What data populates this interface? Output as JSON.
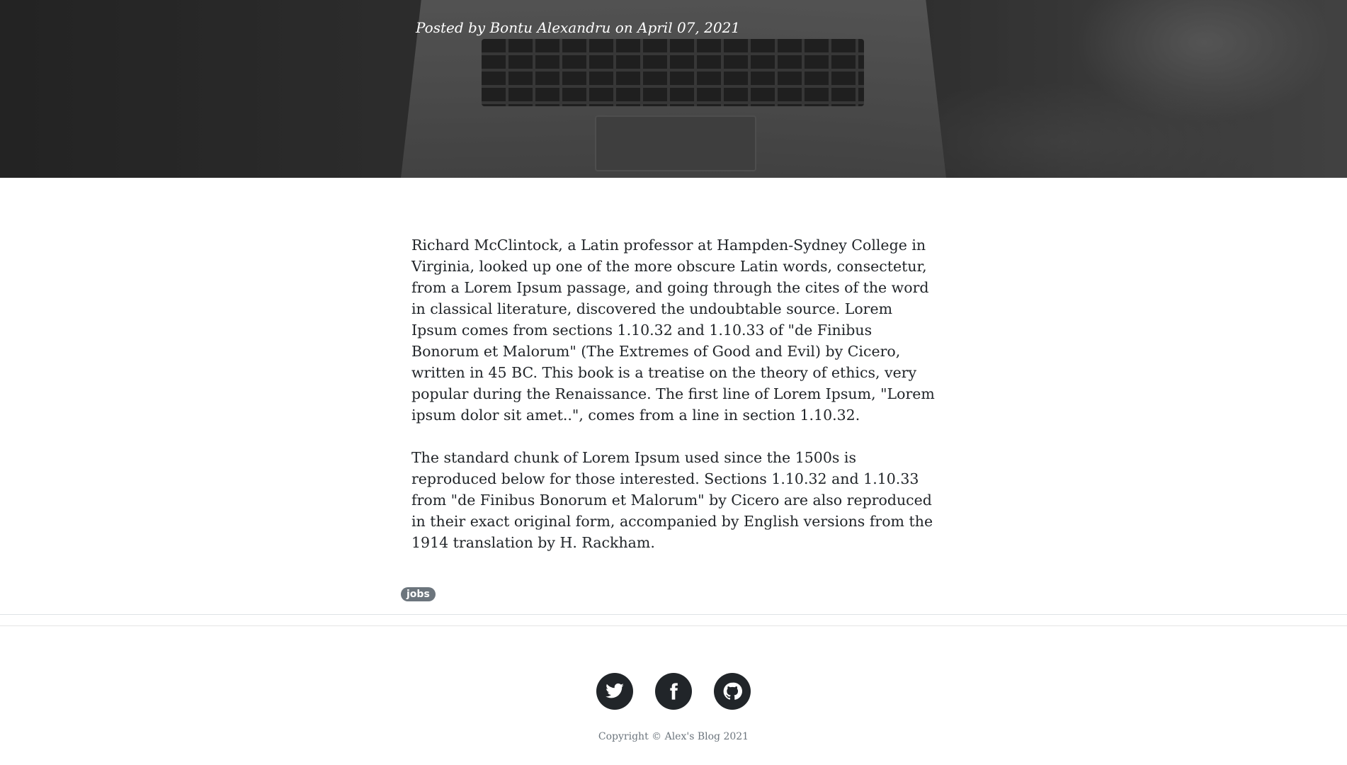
{
  "post": {
    "meta_prefix": "Posted by",
    "author": "Bontu Alexandru",
    "meta_middle": "on",
    "date": "April 07, 2021",
    "paragraphs": [
      "Richard McClintock, a Latin professor at Hampden-Sydney College in Virginia, looked up one of the more obscure Latin words, consectetur, from a Lorem Ipsum passage, and going through the cites of the word in classical literature, discovered the undoubtable source. Lorem Ipsum comes from sections 1.10.32 and 1.10.33 of \"de Finibus Bonorum et Malorum\" (The Extremes of Good and Evil) by Cicero, written in 45 BC. This book is a treatise on the theory of ethics, very popular during the Renaissance. The first line of Lorem Ipsum, \"Lorem ipsum dolor sit amet..\", comes from a line in section 1.10.32.",
      "The standard chunk of Lorem Ipsum used since the 1500s is reproduced below for those interested. Sections 1.10.32 and 1.10.33 from \"de Finibus Bonorum et Malorum\" by Cicero are also reproduced in their exact original form, accompanied by English versions from the 1914 translation by H. Rackham."
    ],
    "tags": [
      "jobs"
    ]
  },
  "footer": {
    "social_icons": [
      "twitter-icon",
      "facebook-icon",
      "github-icon"
    ],
    "copyright": "Copyright © Alex's Blog 2021"
  },
  "colors": {
    "text": "#212529",
    "tag_bg": "#6c757d",
    "social_bg": "#212529"
  }
}
